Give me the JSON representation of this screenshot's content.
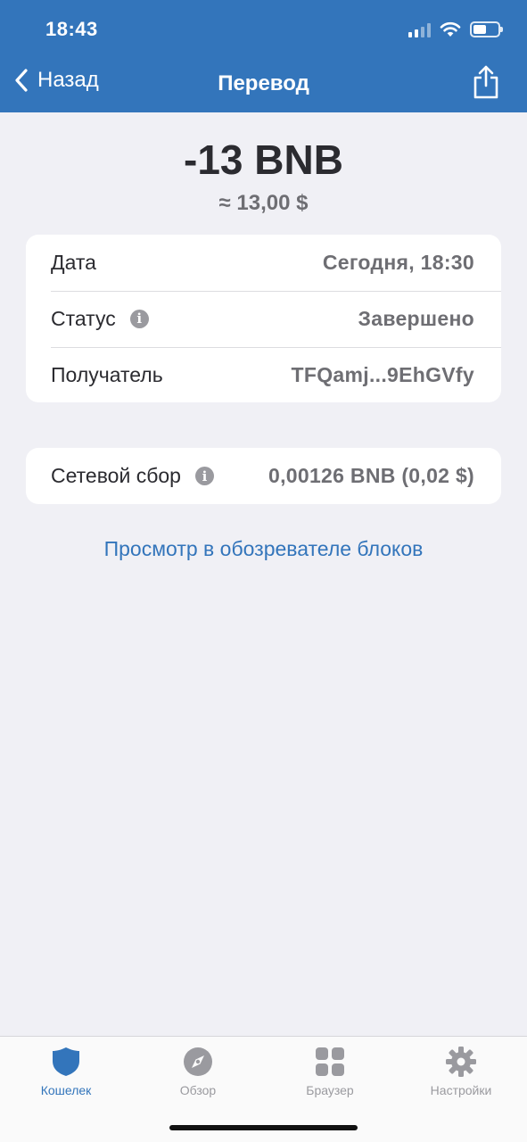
{
  "status_bar": {
    "time": "18:43"
  },
  "nav": {
    "back_label": "Назад",
    "title": "Перевод"
  },
  "transaction": {
    "amount": "-13 BNB",
    "fiat": "≈ 13,00 $"
  },
  "details": [
    {
      "label": "Дата",
      "value": "Сегодня, 18:30",
      "info": false
    },
    {
      "label": "Статус",
      "value": "Завершено",
      "info": true
    },
    {
      "label": "Получатель",
      "value": "TFQamj...9EhGVfy",
      "info": false
    }
  ],
  "fee": {
    "label": "Сетевой сбор",
    "value": "0,00126 BNB (0,02 $)"
  },
  "explorer_link": "Просмотр в обозревателе блоков",
  "tabs": [
    {
      "label": "Кошелек",
      "icon": "shield-icon",
      "active": true
    },
    {
      "label": "Обзор",
      "icon": "compass-icon",
      "active": false
    },
    {
      "label": "Браузер",
      "icon": "grid-icon",
      "active": false
    },
    {
      "label": "Настройки",
      "icon": "gear-icon",
      "active": false
    }
  ],
  "colors": {
    "accent": "#3375bb",
    "background": "#f0f0f5",
    "secondary_text": "#6e6e73"
  }
}
